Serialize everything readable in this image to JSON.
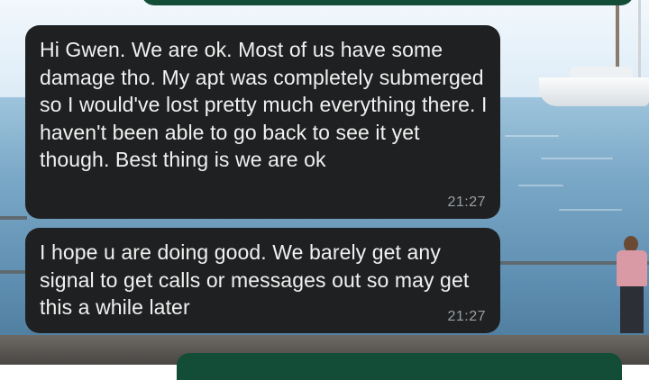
{
  "messages": [
    {
      "text": "Hi Gwen. We are ok. Most of us have some damage tho. My apt was completely submerged so I would've lost pretty much everything there. I haven't been able to go back to see it yet though. Best thing is we are ok",
      "time": "21:27"
    },
    {
      "text": "I hope u are doing good. We barely get any signal to get calls or messages out so may get this a while later",
      "time": "21:27"
    }
  ],
  "colors": {
    "incoming_bubble": "#1f2021",
    "outgoing_bubble": "#144d37",
    "message_text": "#f1f1f1",
    "timestamp_text": "#9aa0a4"
  }
}
